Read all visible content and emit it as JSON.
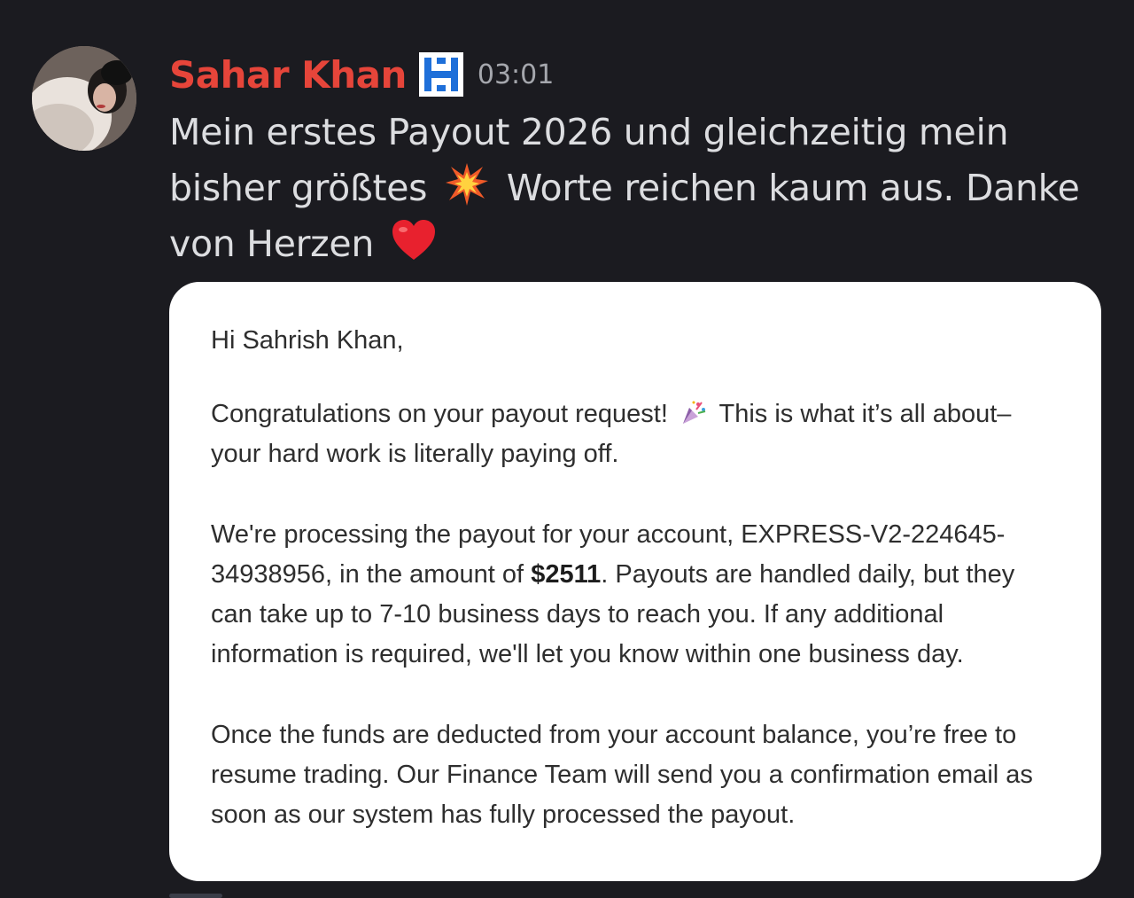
{
  "message": {
    "author": "Sahar Khan",
    "author_color": "#e6453a",
    "role_badge_icon": "h-monogram-badge-icon",
    "timestamp": "03:01",
    "text_part1": "Mein erstes Payout 2026 und gleichzeitig mein bisher größtes",
    "emoji_1": "collision-emoji-icon",
    "text_part2": "Worte reichen kaum aus. Danke von Herzen",
    "emoji_2": "red-heart-emoji-icon"
  },
  "attachment": {
    "greeting": "Hi Sahrish Khan,",
    "p1_part1": "Congratulations on your payout request!",
    "p1_emoji": "party-popper-icon",
    "p1_part2": "This is what it’s all about– your hard work is literally paying off.",
    "p2_part1": "We're processing the payout for your account, EXPRESS-V2-224645-34938956, in the amount of",
    "p2_amount": "$2511",
    "p2_part2": ". Payouts are handled daily, but they can take up to 7-10 business days to reach you. If any additional information is required, we'll let you know within one business day.",
    "p3": "Once the funds are deducted from your account balance, you’re free to resume trading. Our Finance Team will send you a confirmation email as soon as our system has fully processed the payout."
  },
  "colors": {
    "background": "#1b1b20",
    "message_text": "#dcdde0",
    "timestamp": "#a5a7ad",
    "badge_blue": "#1e6fd9"
  }
}
